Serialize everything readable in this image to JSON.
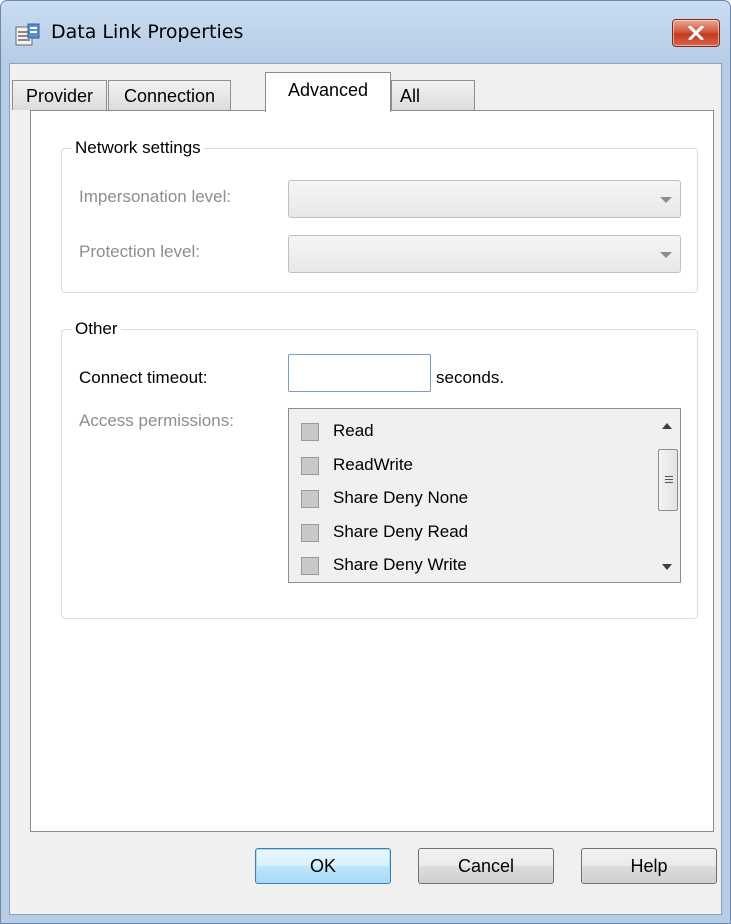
{
  "window": {
    "title": "Data Link Properties",
    "close_icon": "close-icon"
  },
  "tabs": [
    {
      "label": "Provider",
      "active": false
    },
    {
      "label": "Connection",
      "active": false
    },
    {
      "label": "Advanced",
      "active": true
    },
    {
      "label": "All",
      "active": false
    }
  ],
  "network_settings": {
    "legend": "Network settings",
    "impersonation_label": "Impersonation level:",
    "impersonation_value": "",
    "protection_label": "Protection level:",
    "protection_value": ""
  },
  "other": {
    "legend": "Other",
    "timeout_label": "Connect timeout:",
    "timeout_value": "",
    "timeout_unit": "seconds.",
    "access_label": "Access permissions:",
    "access_items": [
      {
        "label": "Read",
        "checked": false
      },
      {
        "label": "ReadWrite",
        "checked": false
      },
      {
        "label": "Share Deny None",
        "checked": false
      },
      {
        "label": "Share Deny Read",
        "checked": false
      },
      {
        "label": "Share Deny Write",
        "checked": false
      }
    ]
  },
  "buttons": {
    "ok": "OK",
    "cancel": "Cancel",
    "help": "Help"
  },
  "colors": {
    "titlebar": "#b7cde7",
    "close_button": "#c43a1f",
    "default_button_border": "#3c7fb1",
    "disabled_text": "#8d8d8d"
  }
}
